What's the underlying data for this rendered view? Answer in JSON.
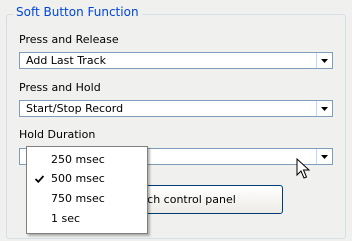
{
  "group": {
    "title": "Soft Button Function"
  },
  "press_release": {
    "label": "Press and Release",
    "value": "Add Last Track"
  },
  "press_hold": {
    "label": "Press and Hold",
    "value": "Start/Stop Record"
  },
  "hold_duration": {
    "label": "Hold Duration",
    "value": "",
    "options": [
      "250 msec",
      "500 msec",
      "750 msec",
      "1 sec"
    ],
    "selected": "500 msec"
  },
  "launch_button": {
    "label_visible": "ch control panel"
  },
  "icons": {
    "dropdown_arrow": "chevron-down-icon",
    "check": "check-icon",
    "cursor": "mouse-pointer-icon"
  },
  "colors": {
    "title": "#0046d5",
    "background": "#f0f0ee",
    "combo_border": "#7f9db9"
  }
}
